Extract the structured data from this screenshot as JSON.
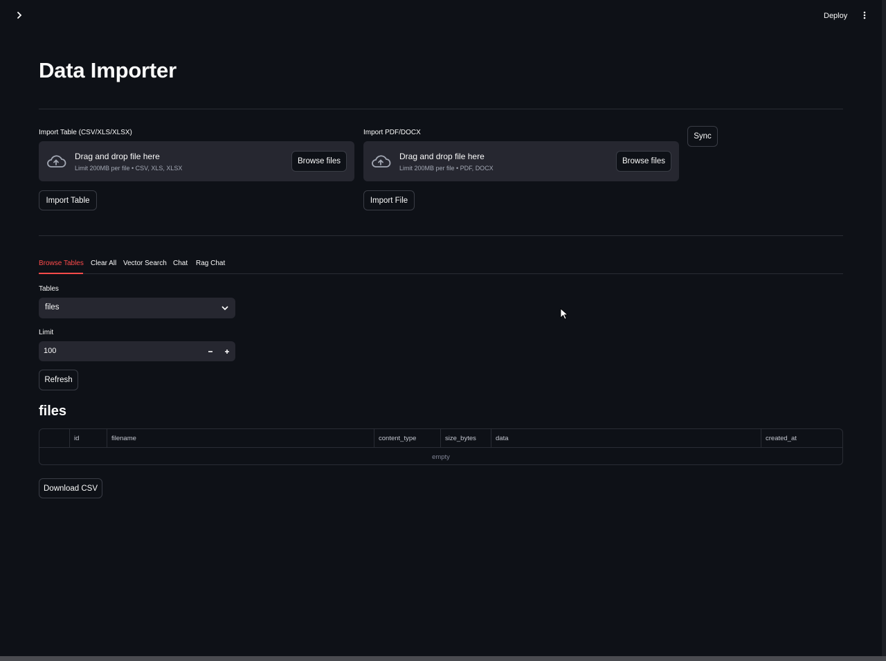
{
  "header": {
    "deploy_label": "Deploy",
    "toggle_icon": "chevron-right-icon",
    "menu_icon": "kebab-menu-icon"
  },
  "page": {
    "title": "Data Importer"
  },
  "importers": {
    "table": {
      "label": "Import Table (CSV/XLS/XLSX)",
      "drop_text": "Drag and drop file here",
      "limit_text": "Limit 200MB per file • CSV, XLS, XLSX",
      "browse_label": "Browse files",
      "action_label": "Import Table"
    },
    "file": {
      "label": "Import PDF/DOCX",
      "drop_text": "Drag and drop file here",
      "limit_text": "Limit 200MB per file • PDF, DOCX",
      "browse_label": "Browse files",
      "action_label": "Import File"
    },
    "sync_label": "Sync"
  },
  "tabs": [
    {
      "label": "Browse Tables",
      "active": true
    },
    {
      "label": "Clear All",
      "active": false
    },
    {
      "label": "Vector Search",
      "active": false
    },
    {
      "label": "Chat",
      "active": false
    },
    {
      "label": "Rag Chat",
      "active": false
    }
  ],
  "browse": {
    "tables_label": "Tables",
    "tables_value": "files",
    "limit_label": "Limit",
    "limit_value": "100",
    "refresh_label": "Refresh",
    "section_title": "files",
    "columns": [
      "id",
      "filename",
      "content_type",
      "size_bytes",
      "data",
      "created_at"
    ],
    "empty_text": "empty",
    "download_label": "Download CSV"
  },
  "colors": {
    "background": "#0e1117",
    "widget": "#262730",
    "accent": "#ff4b4b",
    "text": "#fafafa"
  }
}
